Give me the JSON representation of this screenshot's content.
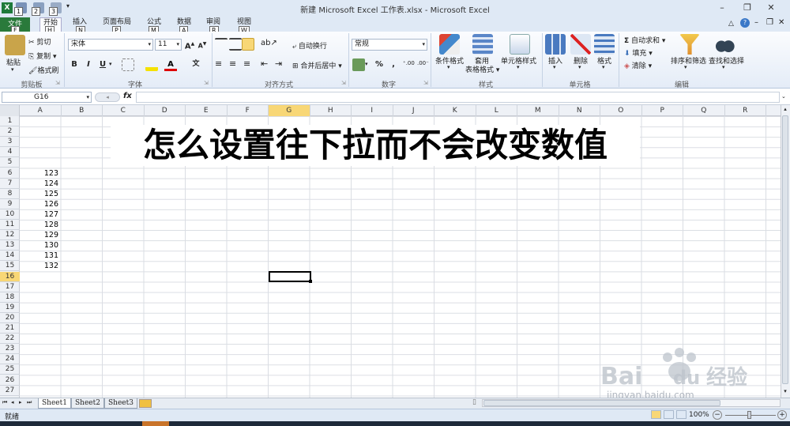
{
  "window": {
    "title": "新建 Microsoft Excel 工作表.xlsx  -  Microsoft Excel",
    "qat_keytips": [
      "1",
      "2",
      "3"
    ]
  },
  "tabs": [
    {
      "label": "文件",
      "keytip": "F"
    },
    {
      "label": "开始",
      "keytip": "H"
    },
    {
      "label": "插入",
      "keytip": "N"
    },
    {
      "label": "页面布局",
      "keytip": "P"
    },
    {
      "label": "公式",
      "keytip": "M"
    },
    {
      "label": "数据",
      "keytip": "A"
    },
    {
      "label": "审阅",
      "keytip": "R"
    },
    {
      "label": "视图",
      "keytip": "W"
    }
  ],
  "ribbon": {
    "clipboard": {
      "paste": "粘贴",
      "cut": "剪切",
      "copy": "复制",
      "format_painter": "格式刷",
      "label": "剪贴板"
    },
    "font": {
      "name": "宋体",
      "size": "11",
      "bold": "B",
      "italic": "I",
      "underline": "U",
      "grow": "A",
      "shrink": "A",
      "wen": "文",
      "label": "字体"
    },
    "alignment": {
      "wrap": "自动换行",
      "merge": "合并后居中",
      "label": "对齐方式"
    },
    "number": {
      "format": "常规",
      "percent": "%",
      "comma": ",",
      "label": "数字"
    },
    "styles": {
      "conditional": "条件格式",
      "table1": "套用",
      "table2": "表格格式",
      "cell_styles": "单元格样式",
      "label": "样式"
    },
    "cells": {
      "insert": "插入",
      "delete": "删除",
      "format": "格式",
      "label": "单元格"
    },
    "editing": {
      "autosum": "自动求和",
      "fill": "填充",
      "clear": "清除",
      "sort": "排序和筛选",
      "find": "查找和选择",
      "label": "编辑"
    }
  },
  "formula_bar": {
    "name_box": "G16",
    "fx": "fx",
    "value": ""
  },
  "columns": [
    "A",
    "B",
    "C",
    "D",
    "E",
    "F",
    "G",
    "H",
    "I",
    "J",
    "K",
    "L",
    "M",
    "N",
    "O",
    "P",
    "Q",
    "R"
  ],
  "rows": [
    "1",
    "2",
    "3",
    "4",
    "5",
    "6",
    "7",
    "8",
    "9",
    "10",
    "11",
    "12",
    "13",
    "14",
    "15",
    "16",
    "17",
    "18",
    "19",
    "20",
    "21",
    "22",
    "23",
    "24",
    "25",
    "26",
    "27"
  ],
  "cells": {
    "title": "怎么设置往下拉而不会改变数值",
    "column_a": [
      "123",
      "124",
      "125",
      "126",
      "127",
      "128",
      "129",
      "130",
      "131",
      "132"
    ]
  },
  "sheets": [
    "Sheet1",
    "Sheet2",
    "Sheet3"
  ],
  "status": {
    "ready": "就绪",
    "zoom": "100%"
  },
  "colors": {
    "accent": "#2a7a3b",
    "selected_header": "#f8d776"
  },
  "watermark": {
    "brand": "Bai",
    "suffix": "du",
    "cn": "经验",
    "url": "jingyan.baidu.com"
  }
}
